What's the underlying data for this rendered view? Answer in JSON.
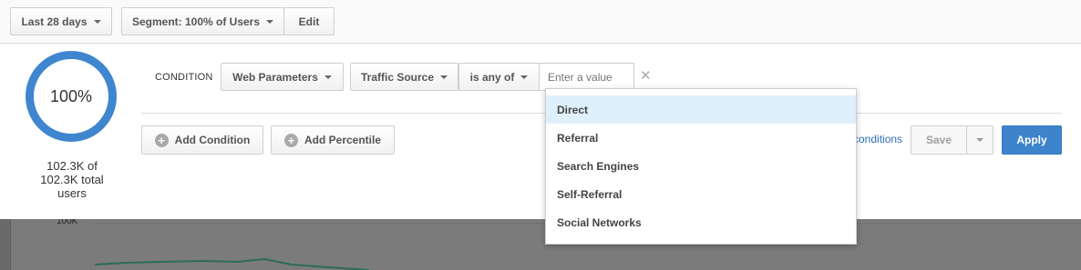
{
  "toolbar": {
    "date_range": "Last 28 days",
    "segment": "Segment: 100% of Users",
    "edit": "Edit"
  },
  "summary": {
    "percent": "100%",
    "caption_line1": "102.3K of",
    "caption_line2": "102.3K total",
    "caption_line3": "users",
    "fraction": 1.0
  },
  "condition": {
    "label": "CONDITION",
    "category": "Web Parameters",
    "dimension": "Traffic Source",
    "operator": "is any of",
    "value_placeholder": "Enter a value",
    "remove_symbol": "✕"
  },
  "actions": {
    "add_condition": "Add Condition",
    "add_percentile": "Add Percentile",
    "conditions_link": "conditions",
    "save": "Save",
    "apply": "Apply"
  },
  "dropdown": {
    "options": [
      "Direct",
      "Referral",
      "Search Engines",
      "Self-Referral",
      "Social Networks"
    ],
    "highlighted": "Direct"
  },
  "chart": {
    "y_tick": "100K",
    "line_color": "#2b6b59"
  },
  "colors": {
    "accent": "#3d84cc",
    "donut": "#3f86cf",
    "highlight": "#def0fb"
  }
}
